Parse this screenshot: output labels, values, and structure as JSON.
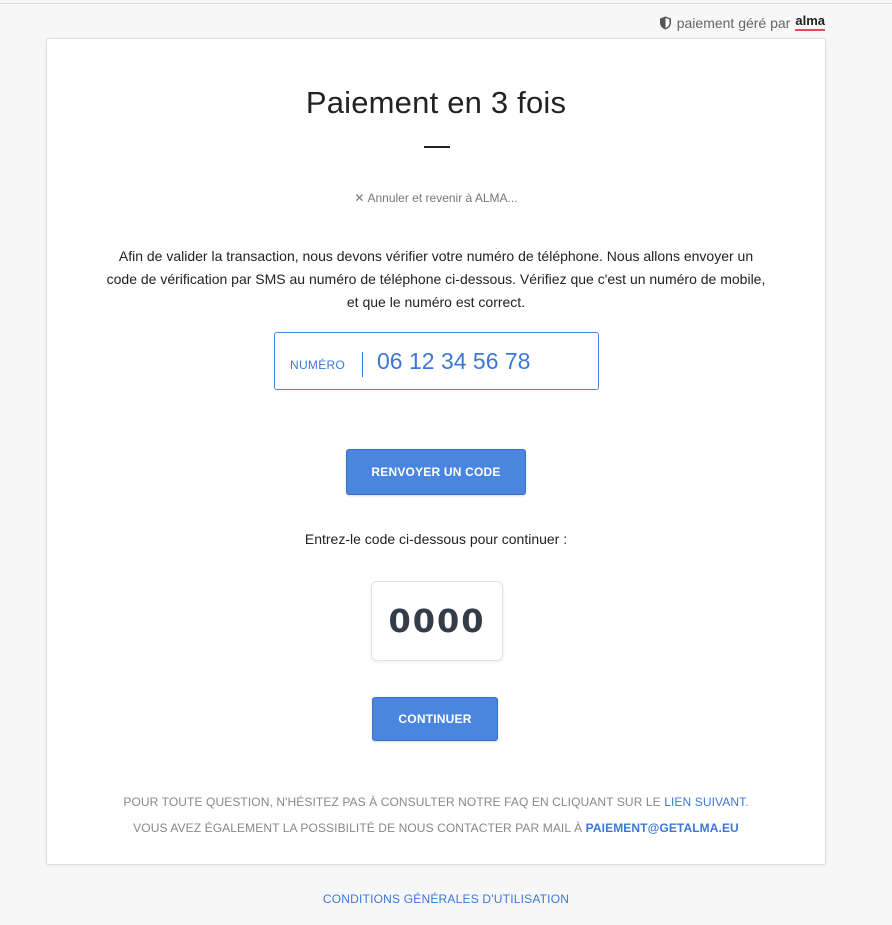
{
  "header": {
    "powered_prefix": "paiement géré par",
    "brand": "alma",
    "brand_underline_color": "#e8485a",
    "shield_icon": "shield-icon"
  },
  "card": {
    "title": "Paiement en 3 fois",
    "cancel_icon": "close-icon",
    "cancel_label": "Annuler et revenir à ALMA...",
    "intro": "Afin de valider la transaction, nous devons vérifier votre numéro de téléphone. Nous allons envoyer un code de vérification par SMS au numéro de téléphone ci-dessous. Vérifiez que c'est un numéro de mobile, et que le numéro est correct.",
    "phone": {
      "label": "NUMÉRO",
      "value": "06 12 34 56 78"
    },
    "resend_button": "RENVOYER UN CODE",
    "code_prompt": "Entrez-le code ci-dessous pour continuer :",
    "code_value": "0000",
    "continue_button": "CONTINUER",
    "footer": {
      "line1_text": "POUR TOUTE QUESTION, N'HÉSITEZ PAS À CONSULTER NOTRE FAQ EN CLIQUANT SUR LE",
      "line1_link": "LIEN SUIVANT",
      "line1_end": ".",
      "line2_text": "VOUS AVEZ ÉGALEMENT LA POSSIBILITÉ DE NOUS CONTACTER PAR MAIL À",
      "line2_email": "PAIEMENT@GETALMA.EU"
    }
  },
  "terms_link": "CONDITIONS GÉNÉRALES D'UTILISATION",
  "colors": {
    "accent": "#4a86e0",
    "link": "#3b78d8",
    "background": "#f7f7f8"
  }
}
